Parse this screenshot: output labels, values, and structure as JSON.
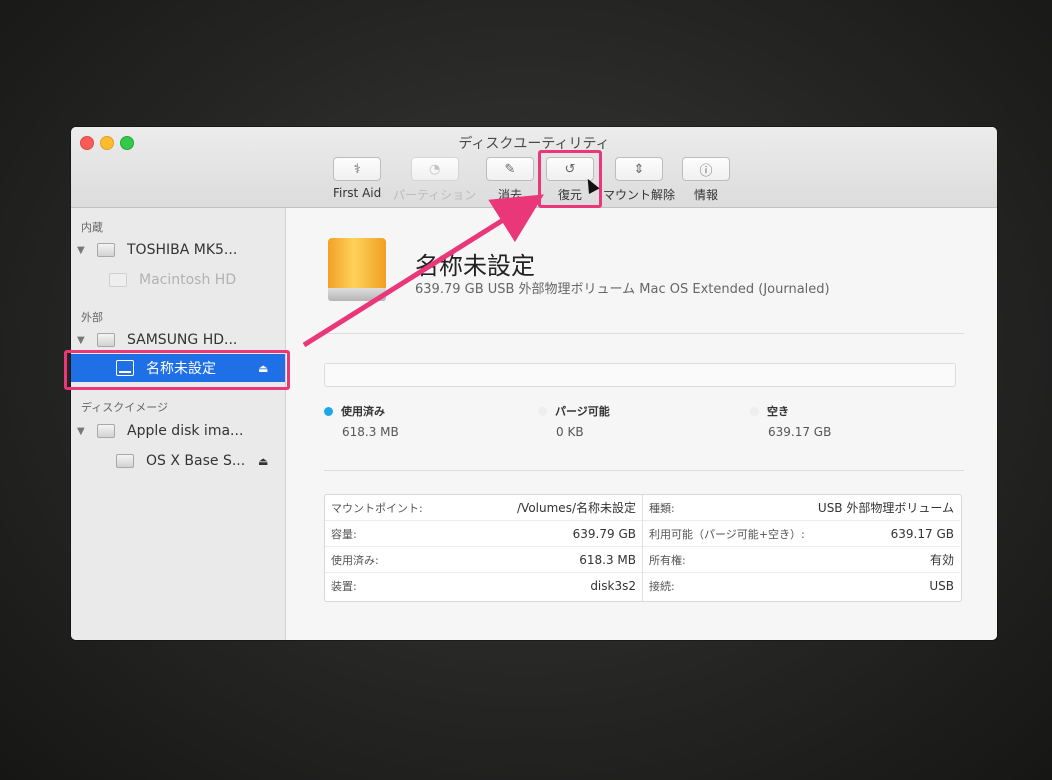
{
  "window": {
    "title": "ディスクユーティリティ"
  },
  "toolbar": [
    {
      "label": "First Aid",
      "icon": "stethoscope-icon",
      "glyph": "⚕",
      "enabled": true
    },
    {
      "label": "パーティション",
      "icon": "partition-icon",
      "glyph": "◔",
      "enabled": false
    },
    {
      "label": "消去",
      "icon": "erase-icon",
      "glyph": "✎",
      "enabled": true
    },
    {
      "label": "復元",
      "icon": "restore-icon",
      "glyph": "↺",
      "enabled": true
    },
    {
      "label": "マウント解除",
      "icon": "unmount-icon",
      "glyph": "⇕",
      "enabled": true
    },
    {
      "label": "情報",
      "icon": "info-icon",
      "glyph": "ⓘ",
      "enabled": true
    }
  ],
  "sidebar": {
    "sections": [
      "内蔵",
      "外部",
      "ディスクイメージ"
    ],
    "items": [
      {
        "label": "TOSHIBA MK5...",
        "level": 0,
        "disclosure": "▼"
      },
      {
        "label": "Macintosh HD",
        "level": 1
      },
      {
        "label": "SAMSUNG HD...",
        "level": 0,
        "disclosure": "▼"
      },
      {
        "label": "名称未設定",
        "level": 1,
        "eject": "⏏",
        "selected": true
      },
      {
        "label": "Apple disk ima...",
        "level": 0,
        "disclosure": "▼"
      },
      {
        "label": "OS X Base S...",
        "level": 1,
        "eject": "⏏"
      }
    ]
  },
  "volume": {
    "name": "名称未設定",
    "description": "639.79 GB USB 外部物理ボリューム Mac OS Extended (Journaled)"
  },
  "usage": {
    "used": {
      "label": "使用済み",
      "value": "618.3 MB",
      "color": "#1ea7e8"
    },
    "purgeable": {
      "label": "パージ可能",
      "value": "0 KB",
      "color": "#eeeeee"
    },
    "free": {
      "label": "空き",
      "value": "639.17 GB",
      "color": "#eeeeee"
    }
  },
  "info": {
    "left": [
      {
        "key": "マウントポイント:",
        "value": "/Volumes/名称未設定"
      },
      {
        "key": "容量:",
        "value": "639.79 GB"
      },
      {
        "key": "使用済み:",
        "value": "618.3 MB"
      },
      {
        "key": "装置:",
        "value": "disk3s2"
      }
    ],
    "right": [
      {
        "key": "種類:",
        "value": "USB 外部物理ボリューム"
      },
      {
        "key": "利用可能（パージ可能+空き）:",
        "value": "639.17 GB"
      },
      {
        "key": "所有権:",
        "value": "有効"
      },
      {
        "key": "接続:",
        "value": "USB"
      }
    ]
  },
  "annotation": {
    "color": "#e9377a"
  }
}
